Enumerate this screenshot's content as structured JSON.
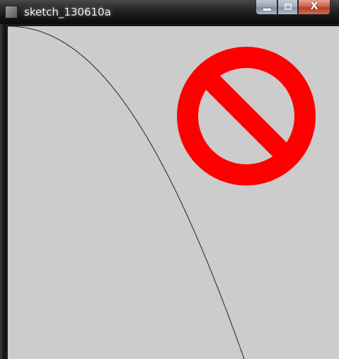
{
  "window": {
    "title": "sketch_130610a",
    "app_icon": "processing-app-icon",
    "controls": {
      "minimize_icon": "minimize-icon",
      "maximize_icon": "maximize-icon",
      "close_icon": "close-icon",
      "close_glyph": "X"
    }
  },
  "canvas": {
    "background": "#cccccc",
    "curve_color": "#000000",
    "prohibition_sign": {
      "icon": "no-entry-icon",
      "color": "#ff0000"
    }
  }
}
